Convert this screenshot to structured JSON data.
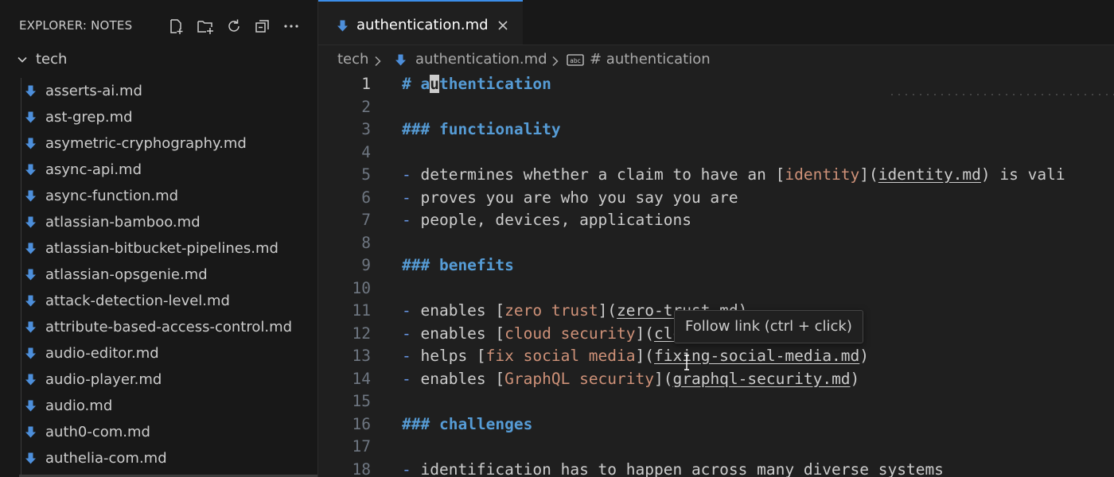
{
  "colors": {
    "accent": "#3b8eea",
    "heading": "#569cd6",
    "link_text": "#ce9178",
    "file_icon": "#4d8fdb"
  },
  "explorer": {
    "title": "EXPLORER: NOTES",
    "actions": [
      "new-file-icon",
      "new-folder-icon",
      "refresh-icon",
      "collapse-all-icon",
      "more-icon"
    ],
    "folder": "tech",
    "files": [
      "asserts-ai.md",
      "ast-grep.md",
      "asymetric-cryphography.md",
      "async-api.md",
      "async-function.md",
      "atlassian-bamboo.md",
      "atlassian-bitbucket-pipelines.md",
      "atlassian-opsgenie.md",
      "attack-detection-level.md",
      "attribute-based-access-control.md",
      "audio-editor.md",
      "audio-player.md",
      "audio.md",
      "auth0-com.md",
      "authelia-com.md"
    ]
  },
  "tab": {
    "label": "authentication.md"
  },
  "breadcrumb": {
    "folder": "tech",
    "file": "authentication.md",
    "symbol": "# authentication"
  },
  "editor": {
    "active_line": 1,
    "lines": [
      {
        "n": "1",
        "parts": [
          {
            "t": "# ",
            "c": "md-h"
          },
          {
            "t": "a",
            "c": "md-h"
          },
          {
            "t": "u",
            "c": "md-h cursor"
          },
          {
            "t": "thentication",
            "c": "md-h"
          }
        ]
      },
      {
        "n": "2",
        "parts": []
      },
      {
        "n": "3",
        "parts": [
          {
            "t": "### functionality",
            "c": "md-h"
          }
        ]
      },
      {
        "n": "4",
        "parts": []
      },
      {
        "n": "5",
        "parts": [
          {
            "t": "- ",
            "c": "md-bullet"
          },
          {
            "t": "determines whether a claim to have an [",
            "c": ""
          },
          {
            "t": "identity",
            "c": "md-linktext"
          },
          {
            "t": "](",
            "c": ""
          },
          {
            "t": "identity.md",
            "c": "md-url"
          },
          {
            "t": ") is vali",
            "c": ""
          }
        ]
      },
      {
        "n": "6",
        "parts": [
          {
            "t": "- ",
            "c": "md-bullet"
          },
          {
            "t": "proves you are who you say you are",
            "c": ""
          }
        ]
      },
      {
        "n": "7",
        "parts": [
          {
            "t": "- ",
            "c": "md-bullet"
          },
          {
            "t": "people, devices, applications",
            "c": ""
          }
        ]
      },
      {
        "n": "8",
        "parts": []
      },
      {
        "n": "9",
        "parts": [
          {
            "t": "### benefits",
            "c": "md-h"
          }
        ]
      },
      {
        "n": "10",
        "parts": []
      },
      {
        "n": "11",
        "parts": [
          {
            "t": "- ",
            "c": "md-bullet"
          },
          {
            "t": "enables [",
            "c": ""
          },
          {
            "t": "zero trust",
            "c": "md-linktext"
          },
          {
            "t": "](",
            "c": ""
          },
          {
            "t": "zero-trust.md",
            "c": "md-url"
          },
          {
            "t": ")",
            "c": ""
          }
        ]
      },
      {
        "n": "12",
        "parts": [
          {
            "t": "- ",
            "c": "md-bullet"
          },
          {
            "t": "enables [",
            "c": ""
          },
          {
            "t": "cloud security",
            "c": "md-linktext"
          },
          {
            "t": "](",
            "c": ""
          },
          {
            "t": "cloud-security.md",
            "c": "md-url"
          },
          {
            "t": ")",
            "c": ""
          }
        ]
      },
      {
        "n": "13",
        "parts": [
          {
            "t": "- ",
            "c": "md-bullet"
          },
          {
            "t": "helps [",
            "c": ""
          },
          {
            "t": "fix social media",
            "c": "md-linktext"
          },
          {
            "t": "](",
            "c": ""
          },
          {
            "t": "fixing-social-media.md",
            "c": "md-url"
          },
          {
            "t": ")",
            "c": ""
          }
        ]
      },
      {
        "n": "14",
        "parts": [
          {
            "t": "- ",
            "c": "md-bullet"
          },
          {
            "t": "enables [",
            "c": ""
          },
          {
            "t": "GraphQL security",
            "c": "md-linktext"
          },
          {
            "t": "](",
            "c": ""
          },
          {
            "t": "graphql-security.md",
            "c": "md-url"
          },
          {
            "t": ")",
            "c": ""
          }
        ]
      },
      {
        "n": "15",
        "parts": []
      },
      {
        "n": "16",
        "parts": [
          {
            "t": "### challenges",
            "c": "md-h"
          }
        ]
      },
      {
        "n": "17",
        "parts": []
      },
      {
        "n": "18",
        "parts": [
          {
            "t": "- ",
            "c": "md-bullet"
          },
          {
            "t": "identification has to happen across many diverse systems",
            "c": ""
          }
        ]
      }
    ]
  },
  "tooltip": {
    "text": "Follow link (ctrl + click)"
  }
}
